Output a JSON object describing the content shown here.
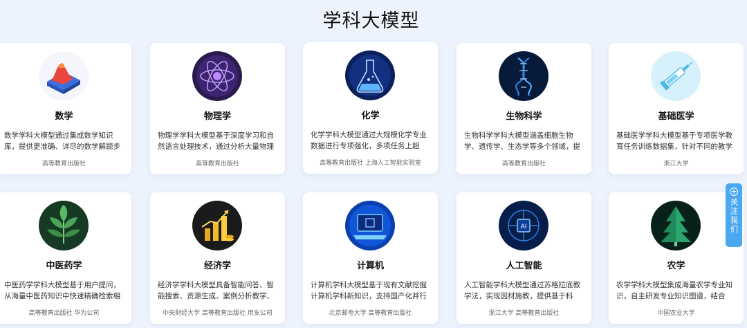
{
  "page": {
    "title": "学科大模型",
    "follow_label": "关注我们"
  },
  "cards": [
    {
      "name": "数学",
      "icon": "math-surface-icon",
      "desc": "数学学科大模型通过集成数学知识库，提供更准确、详尽的数学解题步骤和...",
      "publisher": "高等教育出版社"
    },
    {
      "name": "物理学",
      "icon": "atom-icon",
      "desc": "物理学学科大模型基于深度学习和自然语言处理技术，通过分析大量物理学...",
      "publisher": "高等教育出版社"
    },
    {
      "name": "化学",
      "icon": "flask-icon",
      "desc": "化学学科大模型通过大规模化学专业数据进行专项强化，多项任务上超越...",
      "publisher": "高等教育出版社   上海人工智能实验室"
    },
    {
      "name": "生物科学",
      "icon": "dna-icon",
      "desc": "生物科学学科大模型涵盖细胞生物学、遗传学、生态学等多个领域，提供全...",
      "publisher": "高等教育出版社"
    },
    {
      "name": "基础医学",
      "icon": "syringe-icon",
      "desc": "基础医学学科大模型基于专项医学教育任务训练数据集，针对不同的教学场...",
      "publisher": "浙江大学"
    },
    {
      "name": "中医药学",
      "icon": "leaf-icon",
      "desc": "中医药学学科大模型基于用户提问，从海量中医药知识中快速精确检索相关...",
      "publisher": "高等教育出版社   华为公司"
    },
    {
      "name": "经济学",
      "icon": "coins-chart-icon",
      "desc": "经济学学科大模型具备智能问答、智能搜索、资源生成、案例分析教学、报...",
      "publisher": "中央财经大学   高等教育出版社   用友公司"
    },
    {
      "name": "计算机",
      "icon": "laptop-icon",
      "desc": "计算机学科大模型基于现有文献挖掘计算机学科新知识，支持国产化并行开...",
      "publisher": "北京邮电大学   高等教育出版社"
    },
    {
      "name": "人工智能",
      "icon": "ai-chip-icon",
      "desc": "人工智能学科大模型通过苏格拉底教学法，实现因材施教，提供基于科普、...",
      "publisher": "浙江大学   高等教育出版社"
    },
    {
      "name": "农学",
      "icon": "tree-icon",
      "desc": "农学学科大模型集成海量农学专业知识，自主研发专业知识图谱，结合思...",
      "publisher": "中国农业大学"
    }
  ]
}
